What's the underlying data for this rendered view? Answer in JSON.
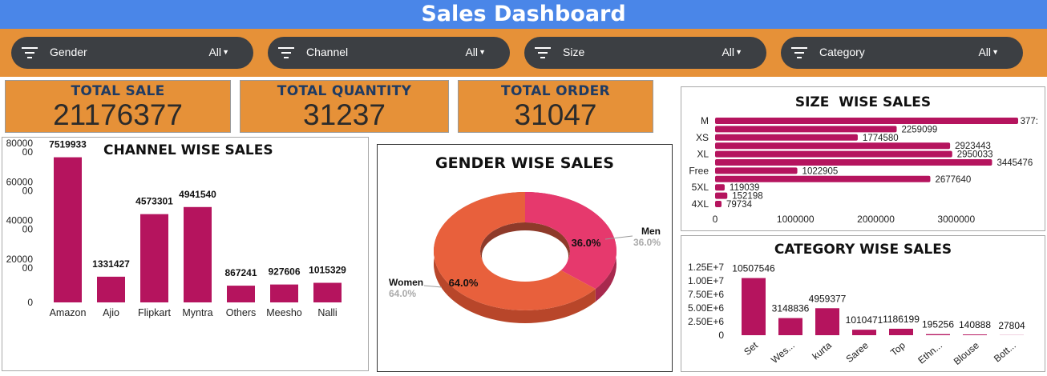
{
  "header": {
    "title": "Sales Dashboard"
  },
  "filters": [
    {
      "label": "Gender",
      "value": "All"
    },
    {
      "label": "Channel",
      "value": "All"
    },
    {
      "label": "Size",
      "value": "All"
    },
    {
      "label": "Category",
      "value": "All"
    }
  ],
  "kpis": [
    {
      "label": "TOTAL SALE",
      "value": "21176377"
    },
    {
      "label": "TOTAL QUANTITY",
      "value": "31237"
    },
    {
      "label": "TOTAL ORDER",
      "value": "31047"
    }
  ],
  "colors": {
    "header": "#4a86e8",
    "band": "#e69138",
    "bar": "#b5145e",
    "women": "#e8603c",
    "men": "#e6396d"
  },
  "chart_data": [
    {
      "id": "channel",
      "type": "bar",
      "title": "CHANNEL WISE SALES",
      "categories": [
        "Amazon",
        "Ajio",
        "Flipkart",
        "Myntra",
        "Others",
        "Meesho",
        "Nalli"
      ],
      "values": [
        7519933,
        1331427,
        4573301,
        4941540,
        867241,
        927606,
        1015329
      ],
      "ylim": [
        0,
        8000000
      ],
      "yticks": [
        0,
        2000000,
        4000000,
        6000000,
        8000000
      ],
      "ytick_labels": [
        [
          "0"
        ],
        [
          "20000",
          "00"
        ],
        [
          "40000",
          "00"
        ],
        [
          "60000",
          "00"
        ],
        [
          "80000",
          "00"
        ]
      ]
    },
    {
      "id": "gender",
      "type": "pie",
      "title": "GENDER WISE SALES",
      "labels": [
        "Men",
        "Women"
      ],
      "values": [
        36.0,
        64.0
      ],
      "value_labels": [
        "36.0%",
        "64.0%"
      ]
    },
    {
      "id": "size",
      "type": "bar",
      "orientation": "horizontal",
      "title": "SIZE  WISE SALES",
      "categories": [
        "M",
        "",
        "XS",
        "",
        "XL",
        "",
        "Free",
        "",
        "5XL",
        "",
        "4XL"
      ],
      "values": [
        3770000,
        2259099,
        1774580,
        2923443,
        2950033,
        3445476,
        1022905,
        2677640,
        119039,
        152198,
        79734
      ],
      "value_labels": [
        "377:",
        "2259099",
        "1774580",
        "2923443",
        "2950033",
        "3445476",
        "1022905",
        "2677640",
        "119039",
        "152198",
        "79734"
      ],
      "xlim": [
        0,
        3770000
      ],
      "xticks": [
        0,
        1000000,
        2000000,
        3000000
      ],
      "xtick_labels": [
        "0",
        "1000000",
        "2000000",
        "3000000"
      ]
    },
    {
      "id": "category",
      "type": "bar",
      "title": "CATEGORY WISE SALES",
      "categories": [
        "Set",
        "Wes...",
        "kurta",
        "Saree",
        "Top",
        "Ethn...",
        "Blouse",
        "Bott..."
      ],
      "values": [
        10507546,
        3148836,
        4959377,
        1010471,
        1186199,
        195256,
        140888,
        27804
      ],
      "value_labels": [
        "10507546",
        "3148836",
        "4959377",
        "1010471",
        "1186199",
        "195256",
        "140888",
        "27804"
      ],
      "ylim": [
        0,
        12500000
      ],
      "yticks": [
        0,
        2500000,
        5000000,
        7500000,
        10000000,
        12500000
      ],
      "ytick_labels": [
        "0",
        "2.50E+6",
        "5.00E+6",
        "7.50E+6",
        "1.00E+7",
        "1.25E+7"
      ]
    }
  ]
}
